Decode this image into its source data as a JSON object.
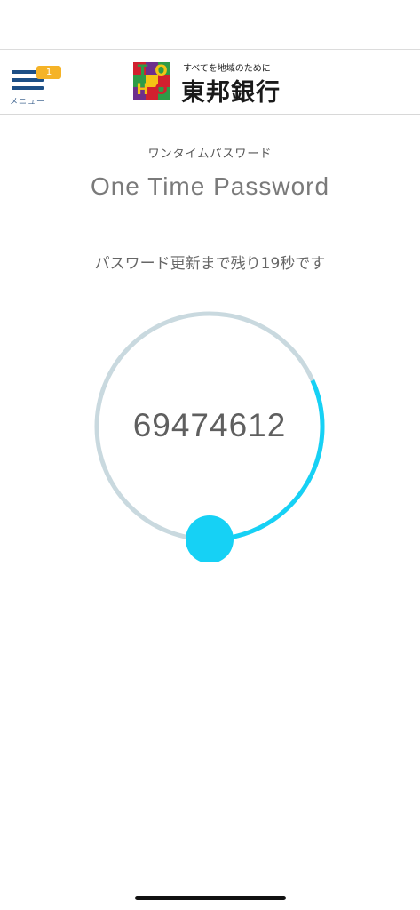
{
  "header": {
    "menu_label": "メニュー",
    "menu_badge": "1",
    "logo_letters": [
      "T",
      "O",
      "H",
      "O"
    ],
    "tagline": "すべてを地域のために",
    "bank_name": "東邦銀行"
  },
  "main": {
    "subtitle_jp": "ワンタイムパスワード",
    "title_en": "One Time Password",
    "countdown_text": "パスワード更新まで残り19秒です",
    "otp": "69474612",
    "timer": {
      "remaining_fraction": 0.317,
      "track_color": "#c9d9df",
      "progress_color": "#16d1f5",
      "knob_color": "#16d1f5"
    }
  },
  "colors": {
    "menu_icon": "#1d4f86",
    "badge": "#f5b327",
    "logo_red": "#d1202f",
    "logo_green": "#2e9b47",
    "logo_purple": "#6d2f8c",
    "logo_yellow": "#f4c414"
  }
}
